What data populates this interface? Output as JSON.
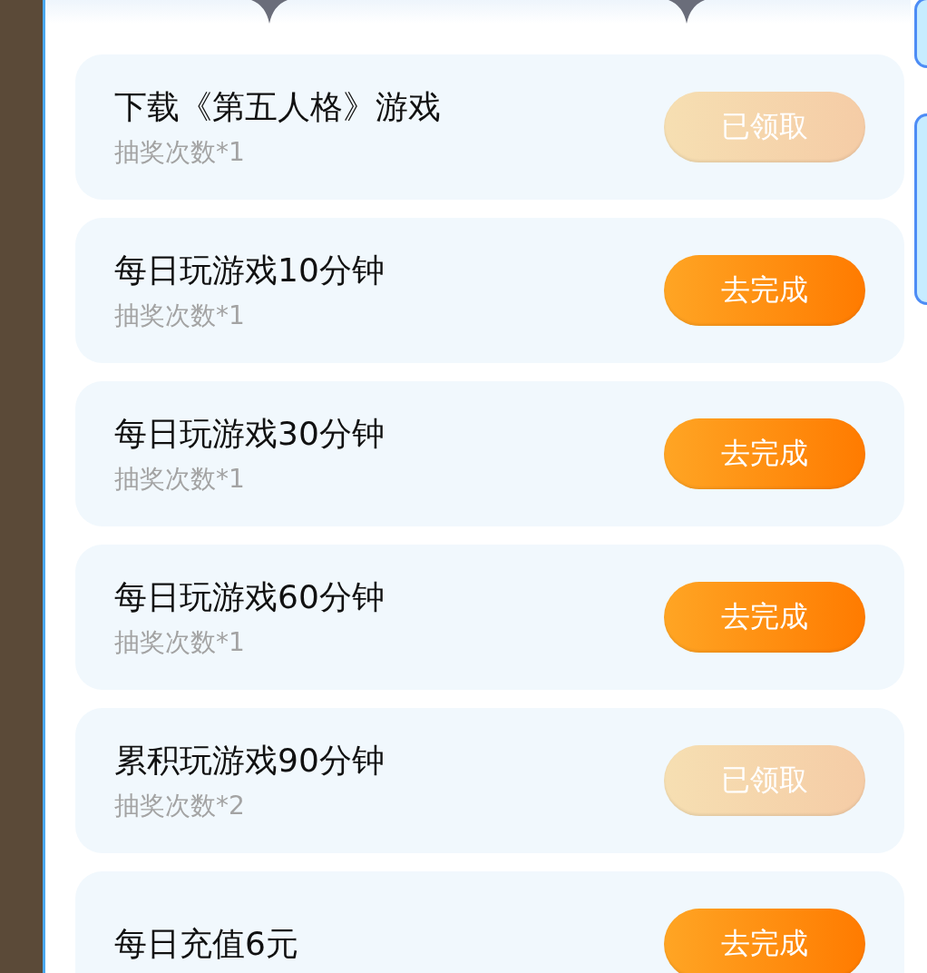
{
  "tasks": [
    {
      "title": "下载《第五人格》游戏",
      "reward": "抽奖次数*1",
      "button": "已领取",
      "claimed": true
    },
    {
      "title": "每日玩游戏10分钟",
      "reward": "抽奖次数*1",
      "button": "去完成",
      "claimed": false
    },
    {
      "title": "每日玩游戏30分钟",
      "reward": "抽奖次数*1",
      "button": "去完成",
      "claimed": false
    },
    {
      "title": "每日玩游戏60分钟",
      "reward": "抽奖次数*1",
      "button": "去完成",
      "claimed": false
    },
    {
      "title": "累积玩游戏90分钟",
      "reward": "抽奖次数*2",
      "button": "已领取",
      "claimed": true
    },
    {
      "title": "每日充值6元",
      "button": "去完成",
      "claimed": false
    }
  ]
}
